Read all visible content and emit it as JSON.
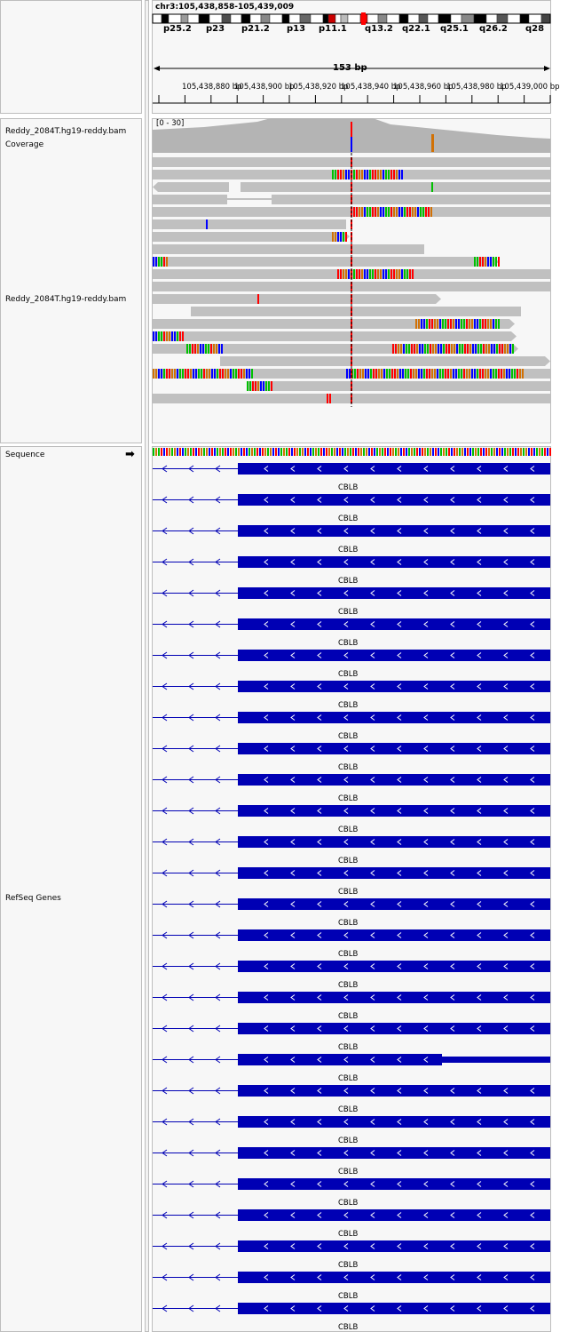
{
  "locus": "chr3:105,438,858-105,439,009",
  "cytobands": [
    "p25.2",
    "p23",
    "p21.2",
    "p13",
    "p11.1",
    "q13.2",
    "q22.1",
    "q25.1",
    "q26.2",
    "q28"
  ],
  "ruler": {
    "span_label": "153 bp",
    "ticks": [
      "105,438,880 bp",
      "105,438,900 bp",
      "105,438,920 bp",
      "105,438,940 bp",
      "105,438,960 bp",
      "105,438,980 bp",
      "105,439,000 bp"
    ]
  },
  "tracks": {
    "coverage_label": "Reddy_2084T.hg19-reddy.bam Coverage",
    "coverage_range": "[0 - 30]",
    "alignment_label": "Reddy_2084T.hg19-reddy.bam",
    "sequence_label": "Sequence",
    "sequence_strand_icon": "right-arrow-icon",
    "refseq_label": "RefSeq Genes"
  },
  "gene": {
    "name": "CBLB",
    "transcript_count": 28,
    "color": "#0000b4"
  },
  "colors": {
    "read": "#c0c0c0",
    "coverage": "#b4b4b4",
    "base_A": "#00c000",
    "base_C": "#0000ff",
    "base_G": "#d17105",
    "base_T": "#ff0000"
  }
}
